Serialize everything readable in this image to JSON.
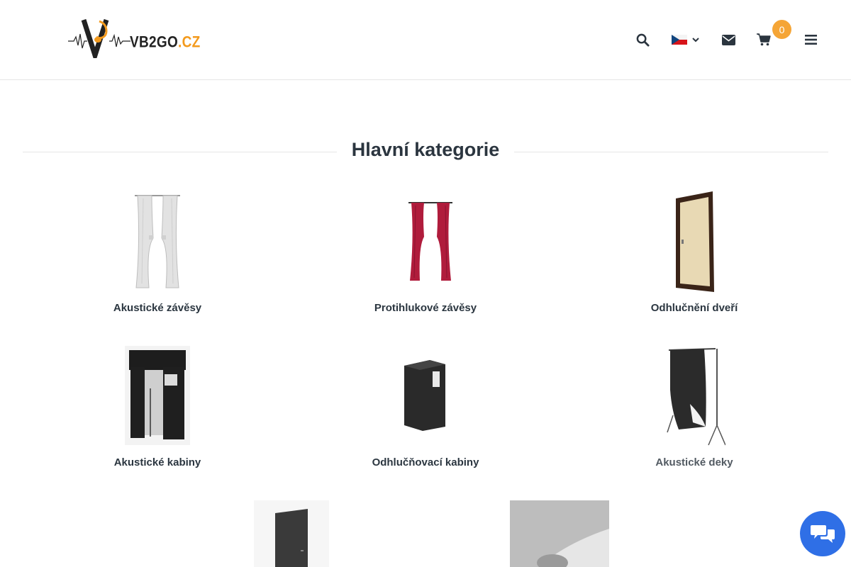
{
  "header": {
    "logo_text_main": "VB2GO",
    "logo_text_tld": ".CZ",
    "cart_count": "0",
    "icons": [
      "search-icon",
      "czech-flag-icon",
      "chevron-down-icon",
      "envelope-icon",
      "cart-icon",
      "hamburger-menu-icon"
    ]
  },
  "main": {
    "section_title": "Hlavní kategorie",
    "categories": [
      {
        "label": "Akustické závěsy"
      },
      {
        "label": "Protihlukové závěsy"
      },
      {
        "label": "Odhlučnění dveří"
      },
      {
        "label": "Akustické kabiny"
      },
      {
        "label": "Odhlučňovací kabiny"
      },
      {
        "label": "Akustické deky"
      }
    ]
  },
  "colors": {
    "accent": "#f5a536",
    "chat": "#2f6fe6",
    "title": "#2b353f"
  },
  "chat": {
    "icon": "chat-bubbles-icon"
  }
}
